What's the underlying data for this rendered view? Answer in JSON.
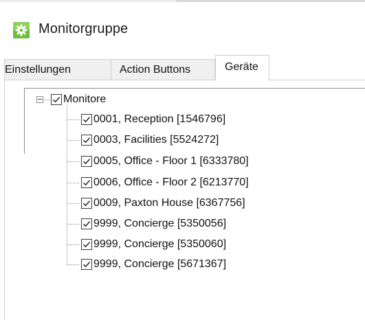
{
  "window": {
    "title": "Monitorgruppe",
    "app_icon": "gear-app-icon",
    "accent_color": "#5fb53a"
  },
  "tabs": [
    {
      "label": "Einstellungen",
      "active": false
    },
    {
      "label": "Action Buttons",
      "active": false
    },
    {
      "label": "Geräte",
      "active": true
    }
  ],
  "tree": {
    "root": {
      "label": "Monitore",
      "checked": true,
      "expanded": true
    },
    "children": [
      {
        "label": "0001, Reception [1546796]",
        "checked": true
      },
      {
        "label": "0003, Facilities [5524272]",
        "checked": true
      },
      {
        "label": "0005, Office - Floor 1 [6333780]",
        "checked": true
      },
      {
        "label": "0006, Office - Floor 2 [6213770]",
        "checked": true
      },
      {
        "label": "0009, Paxton House [6367756]",
        "checked": true
      },
      {
        "label": "9999, Concierge [5350056]",
        "checked": true
      },
      {
        "label": "9999, Concierge [5350060]",
        "checked": true
      },
      {
        "label": "9999, Concierge [5671367]",
        "checked": true
      }
    ]
  }
}
